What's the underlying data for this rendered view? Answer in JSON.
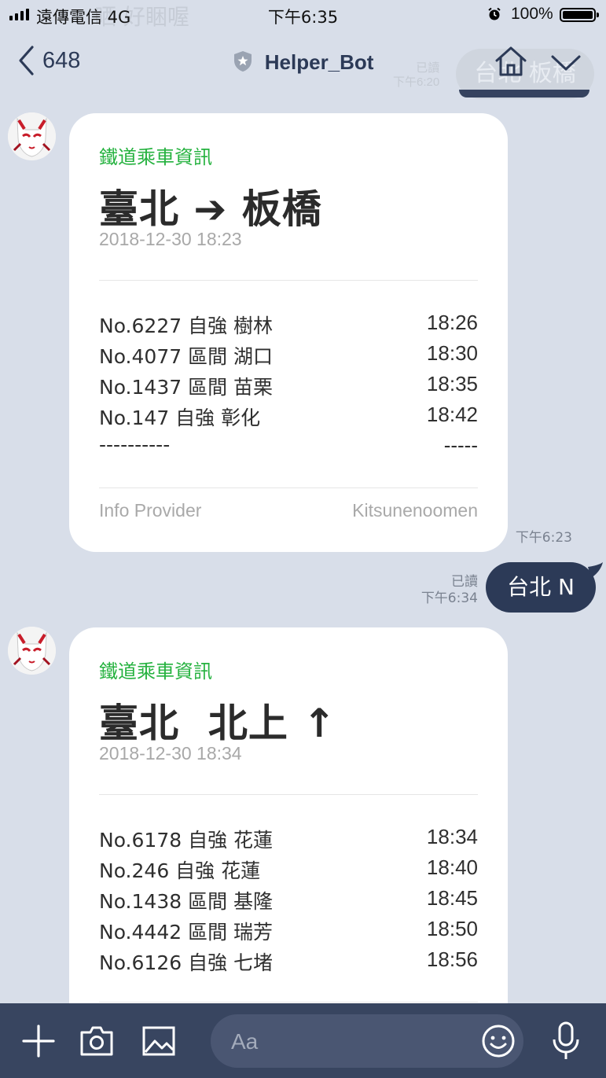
{
  "status": {
    "carrier": "遠傳電信 4G",
    "time": "下午6:35",
    "battery": "100%",
    "ghost_text": "晒 好睏喔"
  },
  "header": {
    "back_count": "648",
    "title": "Helper_Bot",
    "ghost_read": "已讀",
    "ghost_time": "下午6:20",
    "ghost_bubble": "台北 板橋"
  },
  "cards": [
    {
      "label": "鐵道乘車資訊",
      "route": "臺北 ➔ 板橋",
      "date": "2018-12-30 18:23",
      "rows": [
        {
          "train": "No.6227 自強 樹林",
          "time": "18:26"
        },
        {
          "train": "No.4077 區間 湖口",
          "time": "18:30"
        },
        {
          "train": "No.1437 區間 苗栗",
          "time": "18:35"
        },
        {
          "train": "No.147 自強 彰化",
          "time": "18:42"
        },
        {
          "train": "----------",
          "time": "-----"
        }
      ],
      "footer_left": "Info Provider",
      "footer_right": "Kitsunenoomen",
      "sent_time": "下午6:23"
    },
    {
      "label": "鐵道乘車資訊",
      "route": "臺北  北上 ↑",
      "date": "2018-12-30 18:34",
      "rows": [
        {
          "train": "No.6178 自強 花蓮",
          "time": "18:34"
        },
        {
          "train": "No.246 自強 花蓮",
          "time": "18:40"
        },
        {
          "train": "No.1438 區間 基隆",
          "time": "18:45"
        },
        {
          "train": "No.4442 區間 瑞芳",
          "time": "18:50"
        },
        {
          "train": "No.6126 自強 七堵",
          "time": "18:56"
        }
      ]
    }
  ],
  "outgoing": {
    "text": "台北 N",
    "read": "已讀",
    "time": "下午6:34"
  },
  "input": {
    "placeholder": "Aa"
  },
  "colors": {
    "background": "#d8dee9",
    "accent_green": "#25b23f",
    "navy": "#2c3a57",
    "bottombar": "#384560"
  },
  "icons": [
    "back-chevron-icon",
    "shield-icon",
    "home-icon",
    "chevron-down-icon",
    "plus-icon",
    "camera-icon",
    "image-icon",
    "emoji-icon",
    "microphone-icon"
  ]
}
